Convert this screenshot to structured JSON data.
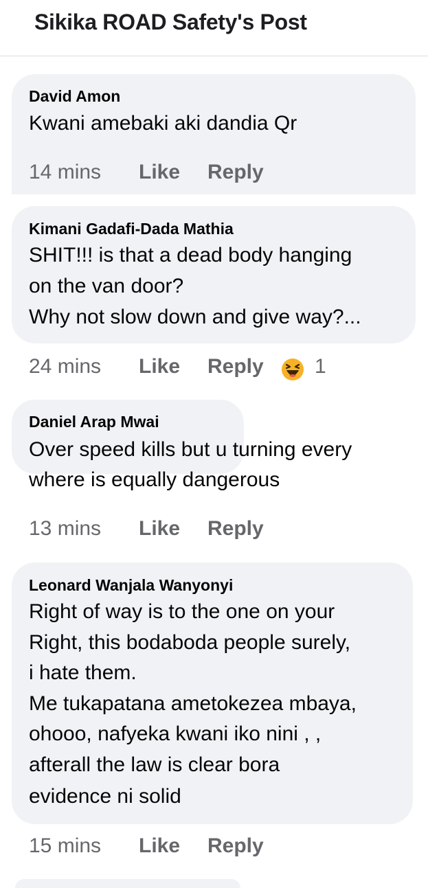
{
  "header": {
    "title": "Sikika ROAD Safety's Post"
  },
  "comments": [
    {
      "author": "David Amon",
      "lines": [
        "Kwani amebaki aki dandia Qr"
      ],
      "time": "14 mins",
      "like_label": "Like",
      "reply_label": "Reply"
    },
    {
      "author": "Kimani Gadafi-Dada Mathia",
      "lines": [
        "SHIT!!!  is that a dead body hanging",
        "on the van door?",
        "Why not slow down and give way?..."
      ],
      "time": "24 mins",
      "like_label": "Like",
      "reply_label": "Reply",
      "reaction": {
        "icon": "haha-emoji-icon",
        "count": "1",
        "color": "#f7b125"
      }
    },
    {
      "author": "Daniel Arap Mwai",
      "lines": [
        "Over speed kills but u turning every",
        "where is equally dangerous"
      ],
      "time": "13 mins",
      "like_label": "Like",
      "reply_label": "Reply"
    },
    {
      "author": "Leonard Wanjala Wanyonyi",
      "lines": [
        "Right of way is to the one on your",
        "Right, this bodaboda people surely,",
        "i hate them.",
        "Me tukapatana ametokezea mbaya,",
        "ohooo, nafyeka kwani iko nini , ,",
        "afterall the law is clear bora",
        "evidence ni solid"
      ],
      "time": "15 mins",
      "like_label": "Like",
      "reply_label": "Reply"
    }
  ],
  "colors": {
    "bubble": "#f0f2f5",
    "meta_text": "#65676b",
    "divider": "#dcdee2"
  }
}
